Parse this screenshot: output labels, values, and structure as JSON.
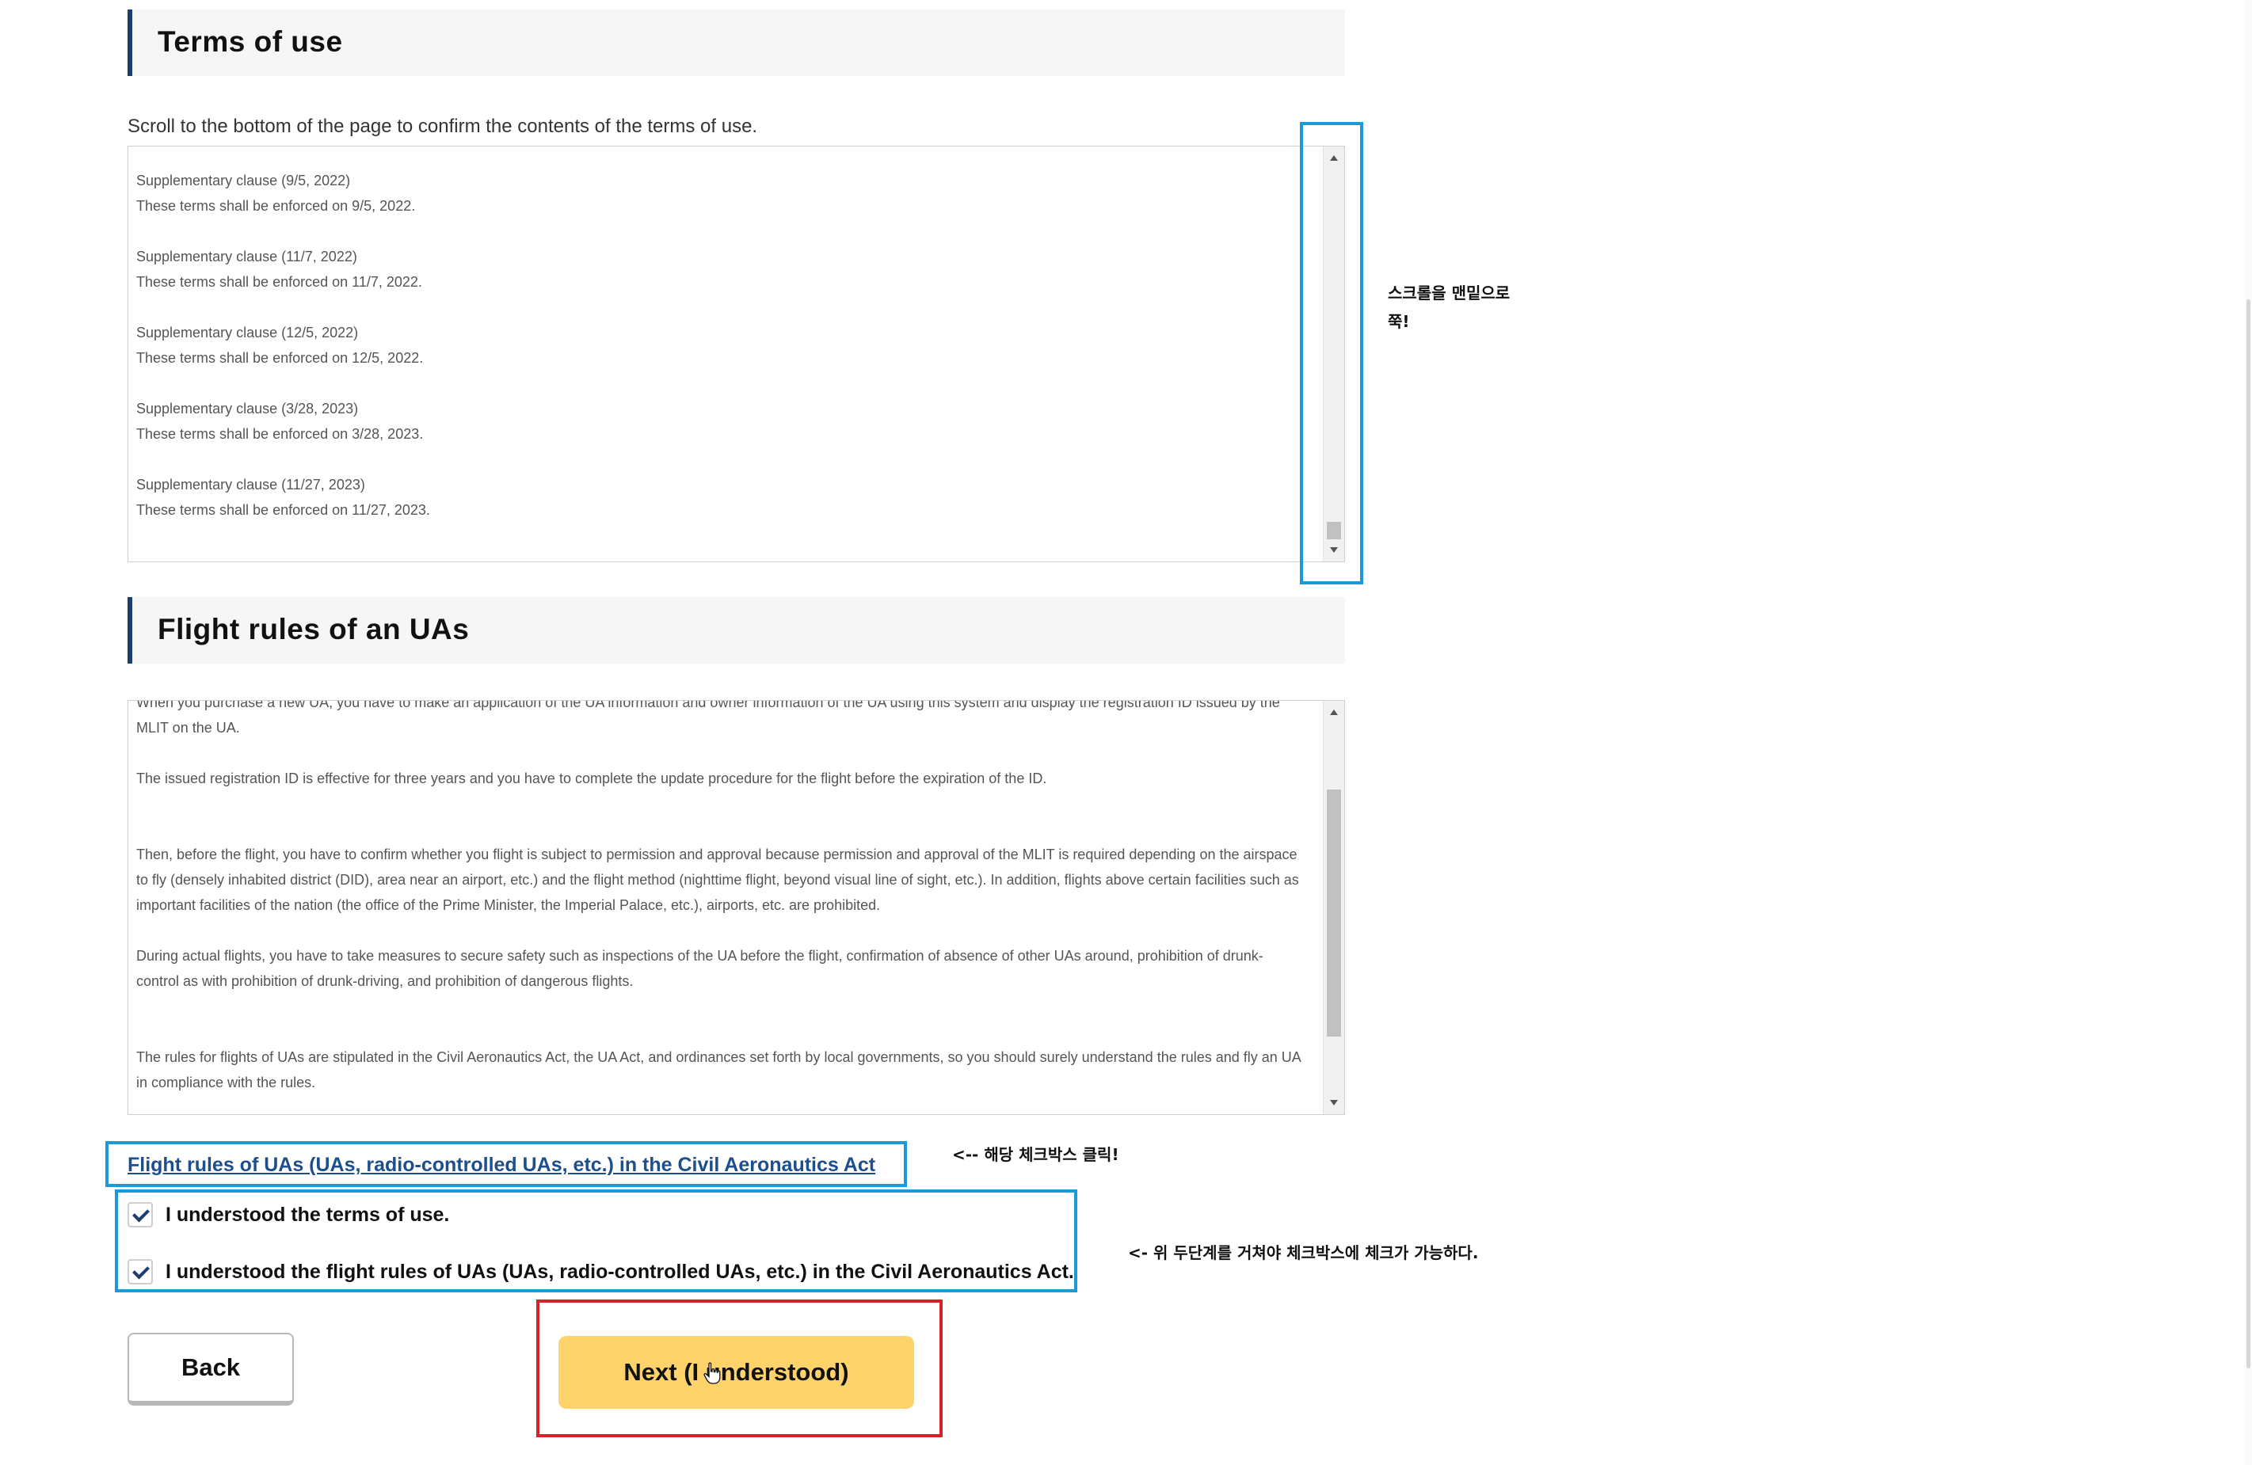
{
  "terms": {
    "heading": "Terms of use",
    "instruction": "Scroll to the bottom of the page to confirm the contents of the terms of use.",
    "clauses": [
      {
        "title": "Supplementary clause (9/5, 2022)",
        "text": "These terms shall be enforced on 9/5, 2022."
      },
      {
        "title": "Supplementary clause (11/7, 2022)",
        "text": "These terms shall be enforced on 11/7, 2022."
      },
      {
        "title": "Supplementary clause (12/5, 2022)",
        "text": "These terms shall be enforced on 12/5, 2022."
      },
      {
        "title": "Supplementary clause (3/28, 2023)",
        "text": "These terms shall be enforced on 3/28, 2023."
      },
      {
        "title": "Supplementary clause (11/27, 2023)",
        "text": "These terms shall be enforced on 11/27, 2023."
      }
    ]
  },
  "flight_rules": {
    "heading": "Flight rules of an UAs",
    "paragraphs": [
      "When you purchase a new UA, you have to make an application of the UA information and owner information of the UA using this system and display the registration ID issued by the MLIT on the UA.",
      "The issued registration ID is effective for three years and you have to complete the update procedure for the flight before the expiration of the ID.",
      "Then, before the flight, you have to confirm whether you flight is subject to permission and approval because permission and approval of the MLIT is required depending on the airspace to fly (densely inhabited district (DID), area near an airport, etc.) and the flight method (nighttime flight, beyond visual line of sight, etc.). In addition, flights above certain facilities such as important facilities of the nation (the office of the Prime Minister, the Imperial Palace, etc.), airports, etc. are prohibited.",
      "During actual flights, you have to take measures to secure safety such as inspections of the UA before the flight, confirmation of absence of other UAs around, prohibition of drunk-control as with prohibition of drunk-driving, and prohibition of dangerous flights.",
      "The rules for flights of UAs are stipulated in the Civil Aeronautics Act, the UA Act, and ordinances set forth by local governments, so you should surely understand the rules and fly an UA in compliance with the rules."
    ],
    "link_text": "Flight rules of UAs (UAs, radio-controlled UAs, etc.) in the Civil Aeronautics Act"
  },
  "checkboxes": [
    {
      "label": "I understood the terms of use.",
      "checked": true
    },
    {
      "label": "I understood the flight rules of UAs (UAs, radio-controlled UAs, etc.) in the Civil Aeronautics Act.",
      "checked": true
    }
  ],
  "buttons": {
    "back": "Back",
    "next": "Next (I understood)"
  },
  "annotations": {
    "scroll_note_line1": "스크롤을 맨밑으로",
    "scroll_note_line2": "쭉!",
    "link_note": "<-- 해당 체크박스 클릭!",
    "checkbox_note": "<- 위 두단계를 거쳐야 체크박스에 체크가 가능하다."
  },
  "colors": {
    "accent_navy": "#1d3f6e",
    "next_button": "#ffd36b",
    "annotation_blue": "#1a9ad6",
    "annotation_red": "#d6202a"
  }
}
